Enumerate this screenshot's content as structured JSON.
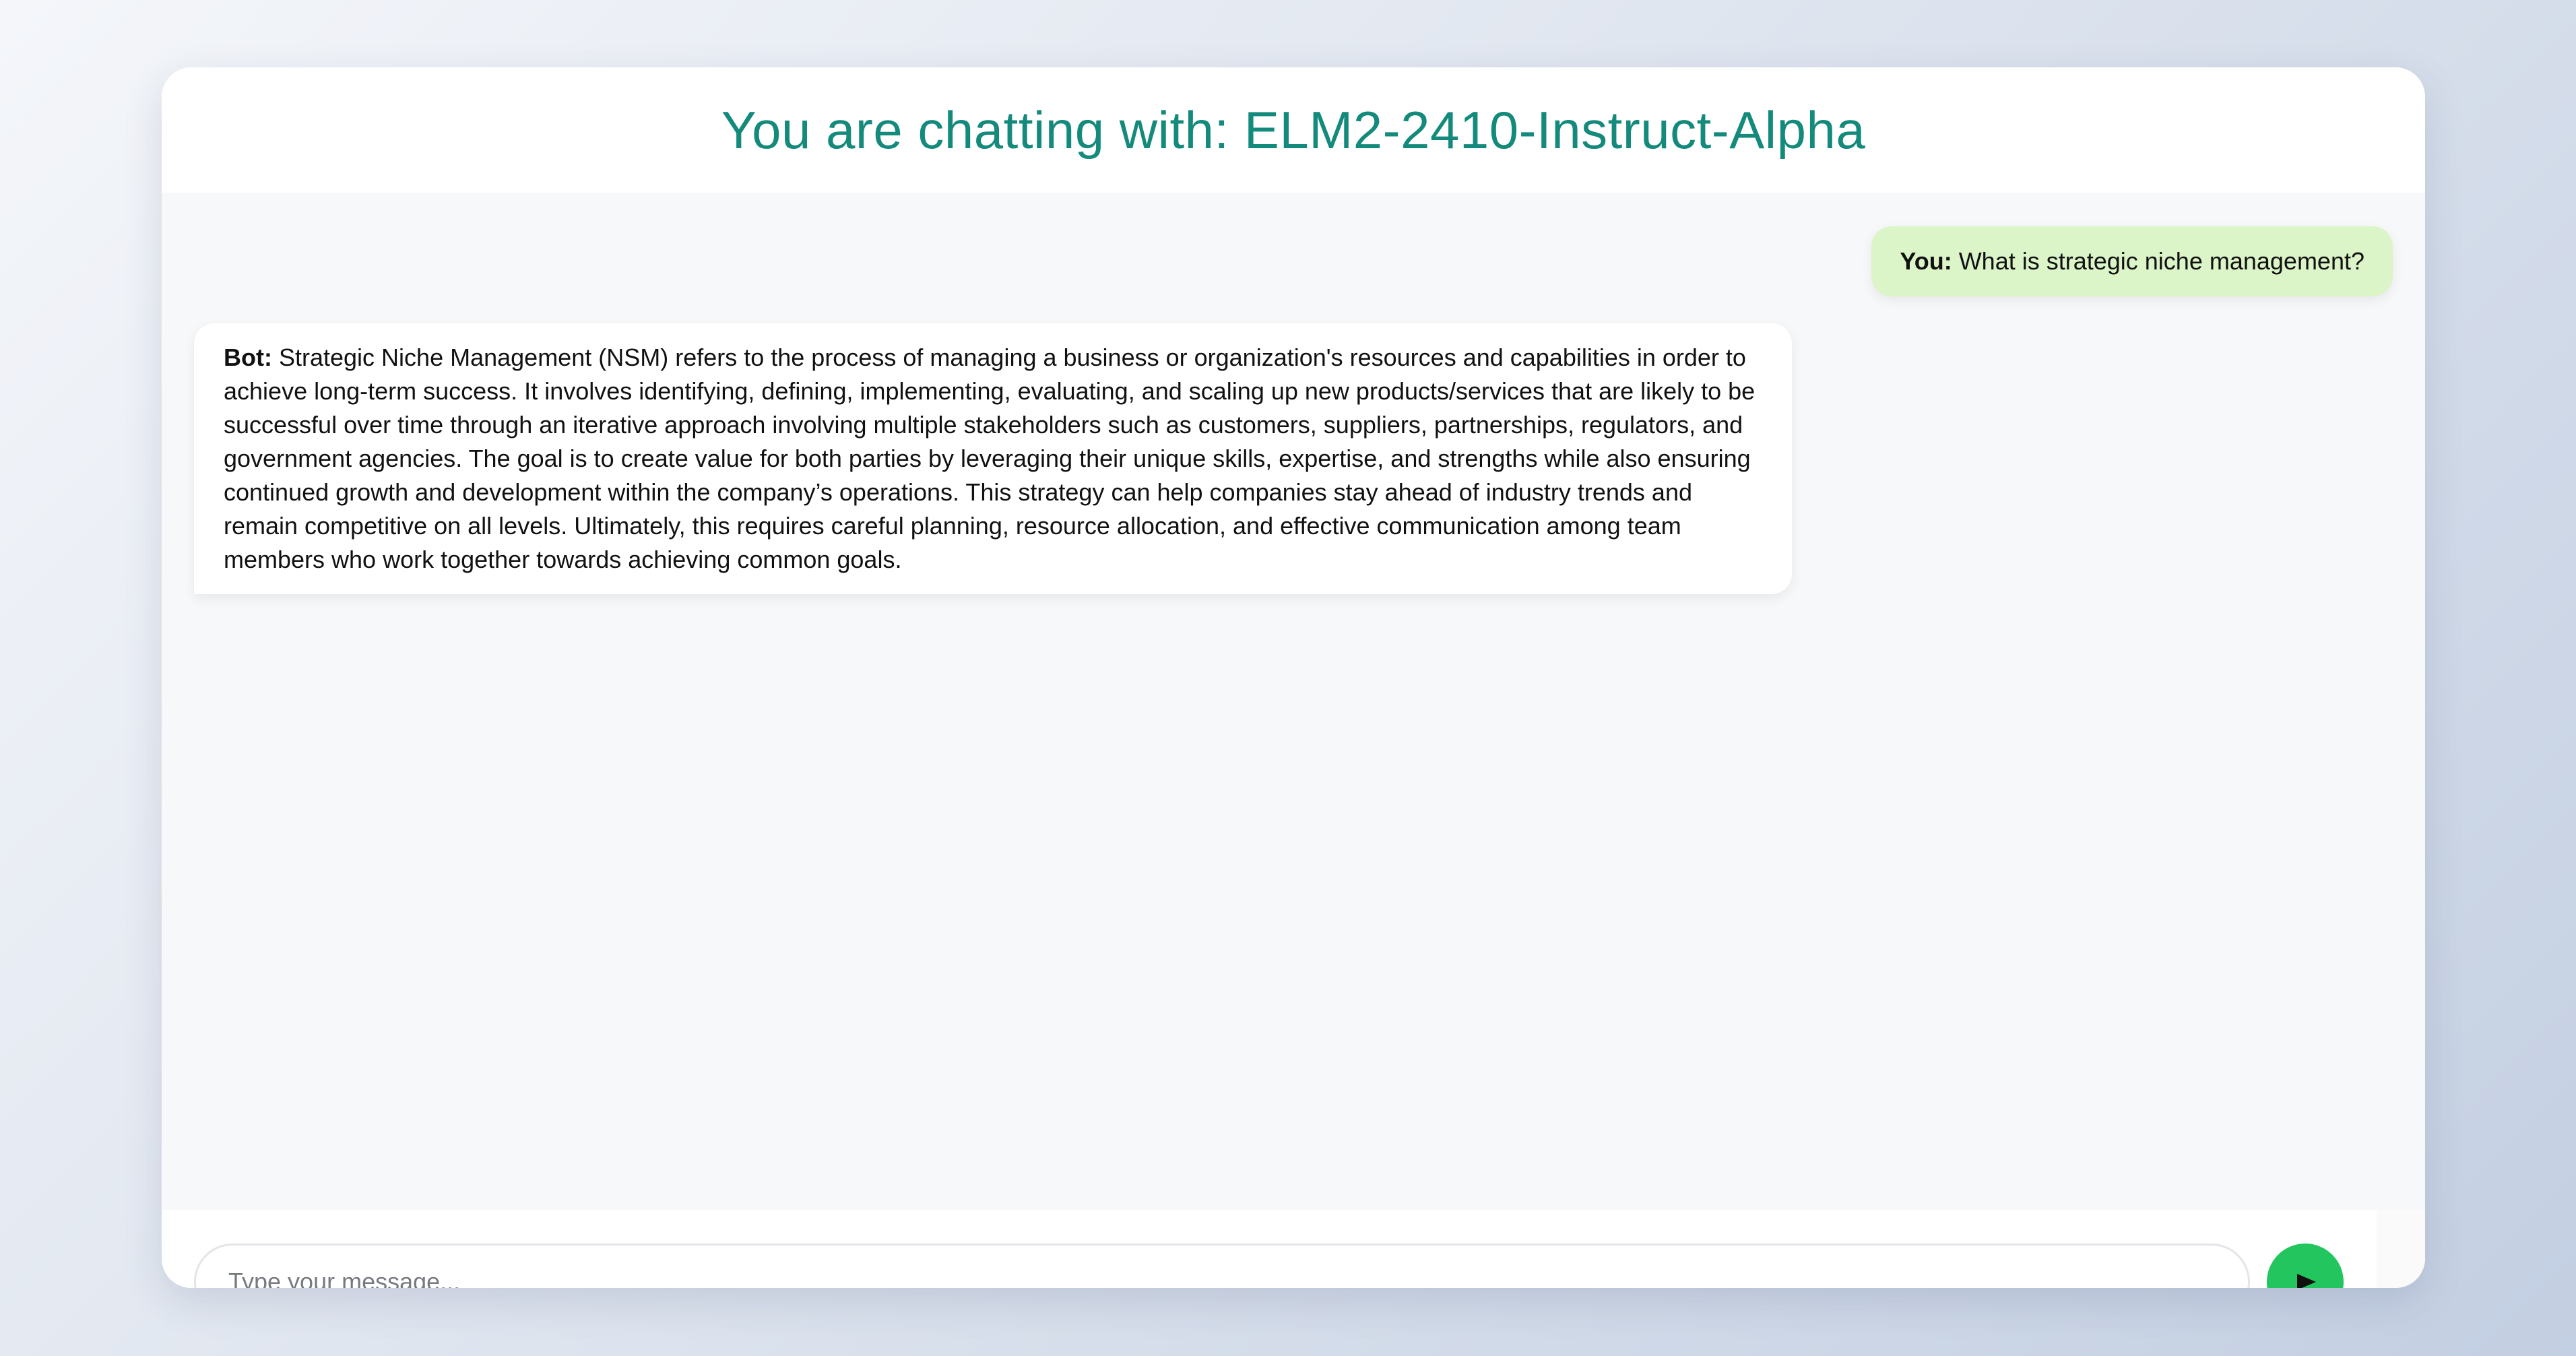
{
  "header": {
    "title": "You are chatting with: ELM2-2410-Instruct-Alpha"
  },
  "messages": [
    {
      "role": "user",
      "speaker": "You:",
      "text": "What is strategic niche management?"
    },
    {
      "role": "bot",
      "speaker": "Bot:",
      "text": "Strategic Niche Management (NSM) refers to the process of managing a business or organization's resources and capabilities in order to achieve long-term success. It involves identifying, defining, implementing, evaluating, and scaling up new products/services that are likely to be successful over time through an iterative approach involving multiple stakeholders such as customers, suppliers, partnerships, regulators, and government agencies. The goal is to create value for both parties by leveraging their unique skills, expertise, and strengths while also ensuring continued growth and development within the company’s operations. This strategy can help companies stay ahead of industry trends and remain competitive on all levels. Ultimately, this requires careful planning, resource allocation, and effective communication among team members who work together towards achieving common goals."
    }
  ],
  "composer": {
    "placeholder": "Type your message...",
    "value": "",
    "send_icon": "send-arrow-icon",
    "send_glyph": "➤"
  },
  "colors": {
    "title": "#138a7b",
    "user_bubble": "#dcf5c8",
    "bot_bubble": "#ffffff",
    "send_button": "#22c55e"
  }
}
